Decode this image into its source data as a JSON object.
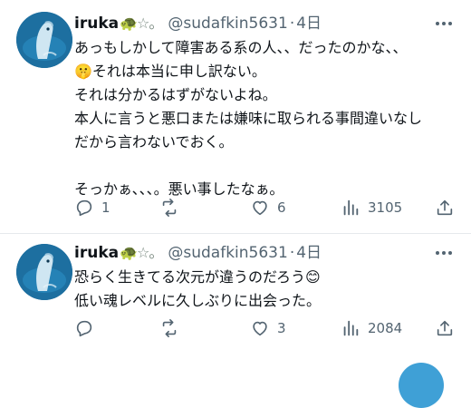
{
  "tweets": [
    {
      "display_name": "iruka",
      "name_deco": "🐢☆。",
      "handle": "@sudafkin5631",
      "sep": "·",
      "time": "4日",
      "text_1": "あっもしかして障害ある系の人、、だったのかな、、",
      "emoji_1": "🤫",
      "text_2": "それは本当に申し訳ない。\nそれは分かるはずがないよね。\n本人に言うと悪口または嫌味に取られる事間違いなし\nだから言わないでおく。\n\nそっかぁ、、、。悪い事したなぁ。",
      "replies": "1",
      "retweets": "",
      "likes": "6",
      "views": "3105"
    },
    {
      "display_name": "iruka",
      "name_deco": "🐢☆。",
      "handle": "@sudafkin5631",
      "sep": "·",
      "time": "4日",
      "text_1": "恐らく生きてる次元が違うのだろう",
      "emoji_1": "😊",
      "text_2": "低い魂レベルに久しぶりに出会った。",
      "replies": "",
      "retweets": "",
      "likes": "3",
      "views": "2084"
    }
  ],
  "icons": {
    "reply": "reply-icon",
    "retweet": "retweet-icon",
    "like": "heart-icon",
    "views": "views-icon",
    "share": "share-icon",
    "more": "more-icon"
  },
  "colors": {
    "text": "#0f1419",
    "secondary": "#536471",
    "divider": "#e6e9ec",
    "avatar": "#1c6f9f"
  }
}
